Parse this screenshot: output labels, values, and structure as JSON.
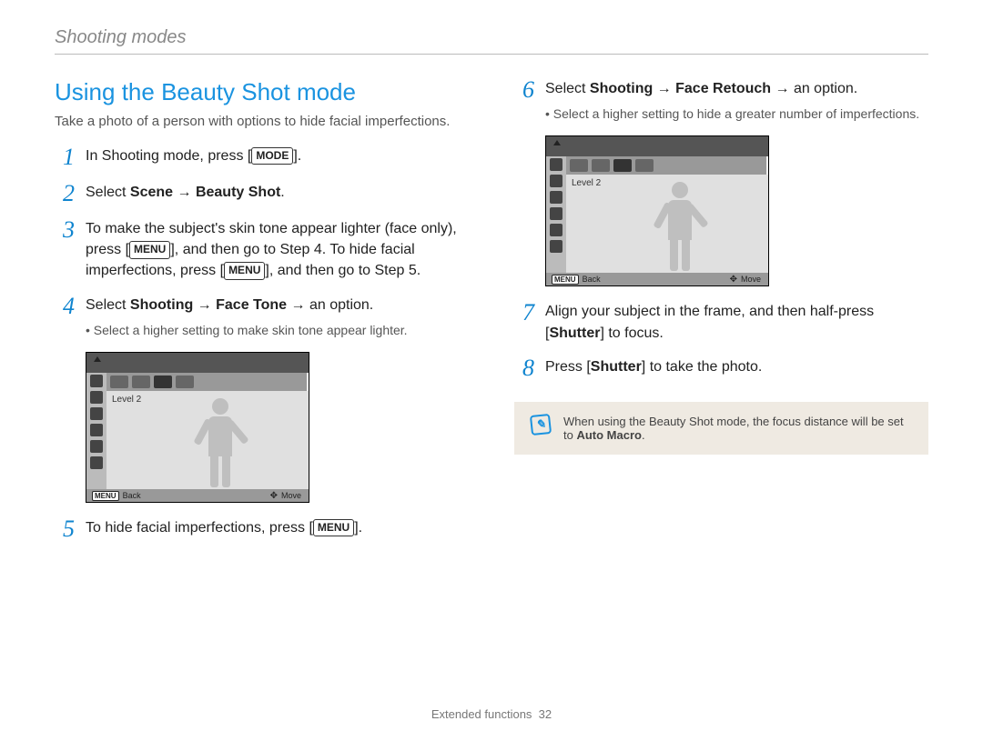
{
  "header": "Shooting modes",
  "title": "Using the Beauty Shot mode",
  "intro": "Take a photo of a person with options to hide facial imperfections.",
  "steps": {
    "s1_a": "In Shooting mode, press [",
    "s1_chip": "MODE",
    "s1_b": "].",
    "s2_a": "Select ",
    "s2_bold": "Scene → Beauty Shot",
    "s2_b": ".",
    "s3_a": "To make the subject's skin tone appear lighter (face only), press [",
    "s3_chip1": "MENU",
    "s3_b": "], and then go to Step 4. To hide facial imperfections, press [",
    "s3_chip2": "MENU",
    "s3_c": "], and then go to Step 5.",
    "s4_a": "Select ",
    "s4_bold": "Shooting → Face Tone",
    "s4_b": " → an option.",
    "s4_sub": "Select a higher setting to make skin tone appear lighter.",
    "s5_a": "To hide facial imperfections, press [",
    "s5_chip": "MENU",
    "s5_b": "].",
    "s6_a": "Select ",
    "s6_bold": "Shooting → Face Retouch",
    "s6_b": " → an option.",
    "s6_sub": "Select a higher setting to hide a greater number of imperfections.",
    "s7_a": "Align your subject in the frame, and then half-press [",
    "s7_bold": "Shutter",
    "s7_b": "] to focus.",
    "s8_a": "Press [",
    "s8_bold": "Shutter",
    "s8_b": "] to take the photo."
  },
  "screenshot": {
    "level": "Level 2",
    "menu_chip": "MENU",
    "back": "Back",
    "move": "Move"
  },
  "note": {
    "icon": "✎",
    "text_a": "When using the Beauty Shot mode, the focus distance will be set to ",
    "text_bold": "Auto Macro",
    "text_b": "."
  },
  "footer": {
    "section": "Extended functions",
    "page": "32"
  }
}
